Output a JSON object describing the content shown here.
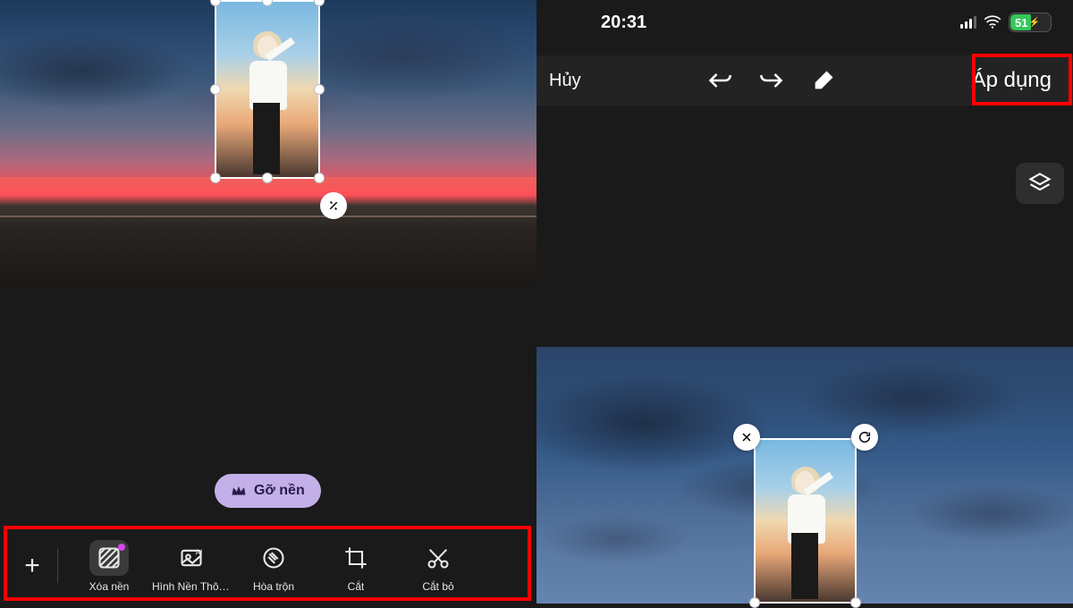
{
  "status_bar": {
    "time": "20:31",
    "battery_percent": "51"
  },
  "top_actions": {
    "cancel": "Hủy",
    "apply": "Áp dụng"
  },
  "pill": {
    "remove_bg": "Gỡ nền"
  },
  "toolbar": {
    "remove_bg": "Xóa nền",
    "smart_bg": "Hình Nền Thôn...",
    "blend": "Hòa trộn",
    "crop": "Cắt",
    "cut": "Cắt bỏ"
  }
}
